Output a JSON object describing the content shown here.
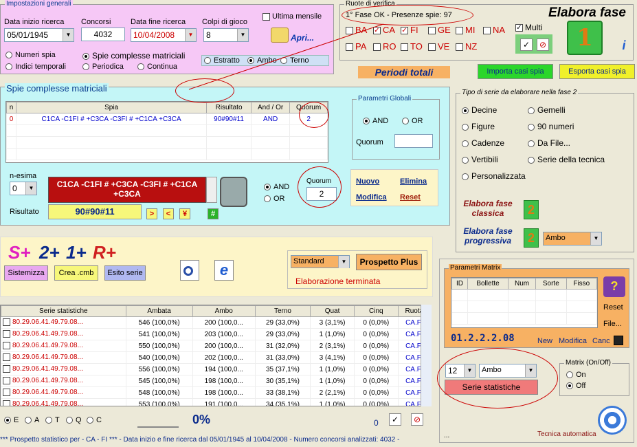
{
  "impostazioni": {
    "legend": "Impostazioni generali",
    "data_inizio_label": "Data inizio ricerca",
    "data_inizio": "05/01/1945",
    "concorsi_label": "Concorsi",
    "concorsi": "4032",
    "data_fine_label": "Data fine ricerca",
    "data_fine": "10/04/2008",
    "colpi_label": "Colpi di gioco",
    "colpi": "8",
    "ultima_mensile": "Ultima mensile",
    "apri": "Apri...",
    "numeri_spia": "Numeri spia",
    "spie_complesse": "Spie complesse matriciali",
    "indici_temporali": "Indici temporali",
    "periodica": "Periodica",
    "continua": "Continua",
    "estratto": "Estratto",
    "ambo": "Ambo",
    "terno": "Terno"
  },
  "ruote": {
    "legend": "Ruote di verifica",
    "status": "1° Fase OK - Presenze spie: 97",
    "items": [
      {
        "name": "BA",
        "checked": false
      },
      {
        "name": "CA",
        "checked": true
      },
      {
        "name": "FI",
        "checked": true
      },
      {
        "name": "GE",
        "checked": false
      },
      {
        "name": "MI",
        "checked": false
      },
      {
        "name": "NA",
        "checked": false
      },
      {
        "name": "PA",
        "checked": false
      },
      {
        "name": "RO",
        "checked": false
      },
      {
        "name": "TO",
        "checked": false
      },
      {
        "name": "VE",
        "checked": false
      },
      {
        "name": "NZ",
        "checked": false
      }
    ],
    "multi": "Multi",
    "check_mark": "✓",
    "cancel_mark": "⊘"
  },
  "elabora_fase": {
    "title": "Elabora fase",
    "number": "1"
  },
  "periodi_totali": "Periodi totali",
  "importa": "Importa casi spia",
  "esporta": "Esporta casi spia",
  "spie": {
    "legend": "Spie complesse matriciali",
    "columns": [
      "n",
      "Spia",
      "Risultato",
      "And / Or",
      "Quorum"
    ],
    "rows": [
      [
        "0",
        "C1CA -C1FI # +C3CA -C3FI # +C1CA +C3CA",
        "90#90#11",
        "AND",
        "2"
      ]
    ],
    "param_legend": "Parametri Globali",
    "and": "AND",
    "or": "OR",
    "quorum_label": "Quorum",
    "nesima_label": "n-esima",
    "nesima": "0",
    "spia_text": "C1CA -C1FI # +C3CA -C3FI # +C1CA +C3CA",
    "risultato_label": "Risultato",
    "risultato": "90#90#11",
    "btn_gt": ">",
    "btn_lt": "<",
    "btn_yen": "¥",
    "btn_hash": "#",
    "quorum_value": "2",
    "nuovo": "Nuovo",
    "elimina": "Elimina",
    "modifica": "Modifica",
    "reset": "Reset"
  },
  "tipo_serie": {
    "legend": "Tipo di serie da elaborare nella fase 2",
    "decine": "Decine",
    "gemelli": "Gemelli",
    "figure": "Figure",
    "novanta": "90 numeri",
    "cadenze": "Cadenze",
    "dafile": "Da File...",
    "vertibili": "Vertibili",
    "serie_tecnica": "Serie della tecnica",
    "personalizzata": "Personalizzata",
    "classica": "Elabora fase classica",
    "progressiva": "Elabora fase progressiva",
    "prog_sel": "Ambo",
    "num2": "2"
  },
  "splus": {
    "s": "S+",
    "two": "2+",
    "one": "1+",
    "r": "R+",
    "sistemizza": "Sistemizza",
    "crea": "Crea .cmb",
    "esito": "Esito serie",
    "standard": "Standard",
    "prospetto": "Prospetto Plus",
    "elaborazione": "Elaborazione terminata"
  },
  "stats": {
    "columns": [
      "Serie statistiche",
      "Ambata",
      "Ambo",
      "Terno",
      "Quat",
      "Cinq",
      "Ruota"
    ],
    "rows": [
      [
        "80.29.06.41.49.79.08...",
        "546 (100,0%)",
        "200 (100,0...",
        "29 (33,0%)",
        "3 (3,1%)",
        "0 (0,0%)",
        "CA.FI"
      ],
      [
        "80.29.06.41.49.79.08...",
        "541 (100,0%)",
        "203 (100,0...",
        "29 (33,0%)",
        "1 (1,0%)",
        "0 (0,0%)",
        "CA.FI"
      ],
      [
        "80.29.06.41.49.79.08...",
        "550 (100,0%)",
        "200 (100,0...",
        "31 (32,0%)",
        "2 (3,1%)",
        "0 (0,0%)",
        "CA.FI"
      ],
      [
        "80.29.06.41.49.79.08...",
        "540 (100,0%)",
        "202 (100,0...",
        "31 (33,0%)",
        "3 (4,1%)",
        "0 (0,0%)",
        "CA.FI"
      ],
      [
        "80.29.06.41.49.79.08...",
        "556 (100,0%)",
        "194 (100,0...",
        "35 (37,1%)",
        "1 (1,0%)",
        "0 (0,0%)",
        "CA.FI"
      ],
      [
        "80.29.06.41.49.79.08...",
        "545 (100,0%)",
        "198 (100,0...",
        "30 (35,1%)",
        "1 (1,0%)",
        "0 (0,0%)",
        "CA.FI"
      ],
      [
        "80.29.06.41.49.79.08...",
        "548 (100,0%)",
        "198 (100,0...",
        "33 (38,1%)",
        "2 (2,1%)",
        "0 (0,0%)",
        "CA.FI"
      ],
      [
        "80.29.06.41.49.79.08...",
        "553 (100,0%)",
        "191 (100,0...",
        "34 (35,1%)",
        "1 (1,0%)",
        "0 (0,0%)",
        "CA.FI"
      ]
    ]
  },
  "bottom": {
    "radio_labels": [
      "E",
      "A",
      "T",
      "Q",
      "C"
    ],
    "percent": "0%",
    "zero": "0",
    "status": "*** Prospetto statistico per  - CA - FI ***  - Data inizio e fine ricerca dal 05/01/1945 al 10/04/2008 - Numero concorsi analizzati: 4032 -"
  },
  "matrix": {
    "legend": "Parametri Matrix",
    "columns": [
      "ID",
      "Bollette",
      "Num",
      "Sorte",
      "Fisso"
    ],
    "reset": "Reset",
    "file": "File...",
    "code": "01.2.2.2.08",
    "new": "New",
    "modifica": "Modifica",
    "canc": "Canc",
    "onoff_legend": "Matrix (On/Off)",
    "on": "On",
    "off": "Off",
    "num_sel": "12",
    "sorte_sel": "Ambo",
    "serie_btn": "Serie statistiche",
    "tecnica": "Tecnica automatica",
    "dots": "..."
  }
}
